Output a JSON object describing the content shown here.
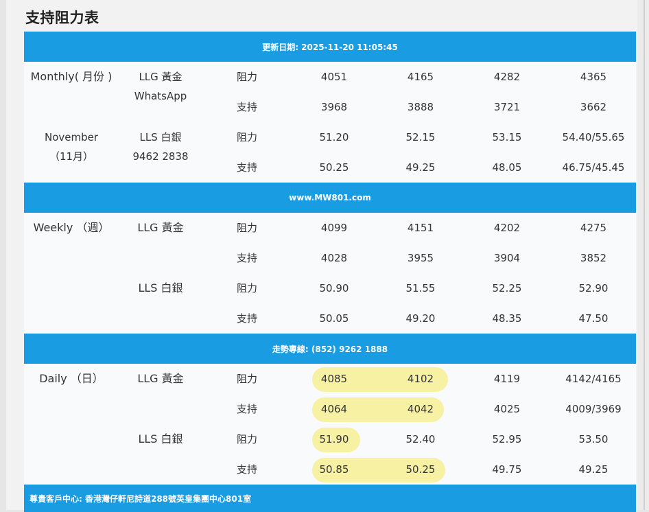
{
  "title": "支持阻力表",
  "bands": {
    "update": "更新日期: 2025-11-20 11:05:45",
    "website": "www.MW801.com",
    "hotline": "走勢專線: (852) 9262 1888",
    "address": "尊貴客戶中心: 香港灣仔軒尼詩道288號英皇集團中心801室"
  },
  "monthly": {
    "label1": "Monthly( 月份 )",
    "label2a": "November",
    "label2b": "（11月）",
    "gold_name": "LLG 黃金",
    "gold_sub": "WhatsApp",
    "silver_name": "LLS 白銀",
    "silver_sub": "9462 2838",
    "rows": [
      {
        "type": "阻力",
        "v": [
          "4051",
          "4165",
          "4282",
          "4365"
        ]
      },
      {
        "type": "支持",
        "v": [
          "3968",
          "3888",
          "3721",
          "3662"
        ]
      },
      {
        "type": "阻力",
        "v": [
          "51.20",
          "52.15",
          "53.15",
          "54.40/55.65"
        ]
      },
      {
        "type": "支持",
        "v": [
          "50.25",
          "49.25",
          "48.05",
          "46.75/45.45"
        ]
      }
    ]
  },
  "weekly": {
    "label": "Weekly （週）",
    "gold_name": "LLG 黃金",
    "silver_name": "LLS 白銀",
    "rows": [
      {
        "type": "阻力",
        "v": [
          "4099",
          "4151",
          "4202",
          "4275"
        ]
      },
      {
        "type": "支持",
        "v": [
          "4028",
          "3955",
          "3904",
          "3852"
        ]
      },
      {
        "type": "阻力",
        "v": [
          "50.90",
          "51.55",
          "52.25",
          "52.90"
        ]
      },
      {
        "type": "支持",
        "v": [
          "50.05",
          "49.20",
          "48.35",
          "47.50"
        ]
      }
    ]
  },
  "daily": {
    "label": "Daily （日）",
    "gold_name": "LLG 黃金",
    "silver_name": "LLS 白銀",
    "rows": [
      {
        "type": "阻力",
        "v": [
          "4085",
          "4102",
          "4119",
          "4142/4165"
        ]
      },
      {
        "type": "支持",
        "v": [
          "4064",
          "4042",
          "4025",
          "4009/3969"
        ]
      },
      {
        "type": "阻力",
        "v": [
          "51.90",
          "52.40",
          "52.95",
          "53.50"
        ]
      },
      {
        "type": "支持",
        "v": [
          "50.85",
          "50.25",
          "49.75",
          "49.25"
        ]
      }
    ]
  },
  "colors": {
    "band": "#1a9ce3",
    "highlight": "#f7f1a4"
  }
}
